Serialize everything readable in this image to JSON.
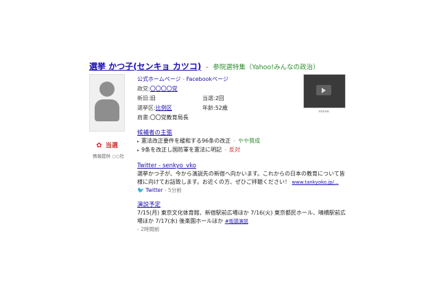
{
  "header": {
    "name": "選挙 かつ子",
    "reading": "(センキョ カツコ)",
    "separator": "-",
    "source": "参院選特集（Yahoo!みんなの政治）"
  },
  "profile": {
    "result_icon": "rose-icon",
    "result_label": "当選",
    "provider": "情報提供 ○○社"
  },
  "links": {
    "official": "公式ホームページ",
    "sep": "-",
    "facebook": "Facebookページ"
  },
  "info": {
    "party_label": "政党:",
    "party_value": "〇〇〇〇党",
    "status_label": "新旧:",
    "status_value": "旧",
    "terms_label": "当選:",
    "terms_value": "2回",
    "district_label": "選挙区:",
    "district_value": "比例区",
    "age_label": "年齢:",
    "age_value": "52歳",
    "title_label": "肩書:",
    "title_value": "〇〇党教育局長"
  },
  "video": {
    "label": "movie"
  },
  "policies": {
    "heading": "候補者の主張",
    "items": [
      {
        "text": "憲法改正要件を緩和する96条の改正",
        "sep": "-",
        "stance": "やや賛成",
        "stance_type": "agree"
      },
      {
        "text": "9条を改正し国防軍を憲法に明記",
        "sep": "-",
        "stance": "反対",
        "stance_type": "oppose"
      }
    ]
  },
  "twitter": {
    "heading": "Twitter - senkyo_vko",
    "text": "選挙かつ子が、今から演説先の新宿へ向かいます。これからの日本の教育について皆様に向けてお話致します。お近くの方、ぜひご拝聴ください！",
    "url": "www.tankyoko.jp/...",
    "bird_icon": "twitter-bird-icon",
    "source": "Twitter",
    "sep": "-",
    "time": "5分前"
  },
  "speech": {
    "heading": "演説予定",
    "text": "7/15(月) 東京文化体育館、新宿駅前広場ほか 7/16(火) 東京都民ホール、晴橋駅前広場ほか 7/17(水) 後楽園ホールほか",
    "tag": "#街頭演説",
    "time": "- 2時間前"
  }
}
